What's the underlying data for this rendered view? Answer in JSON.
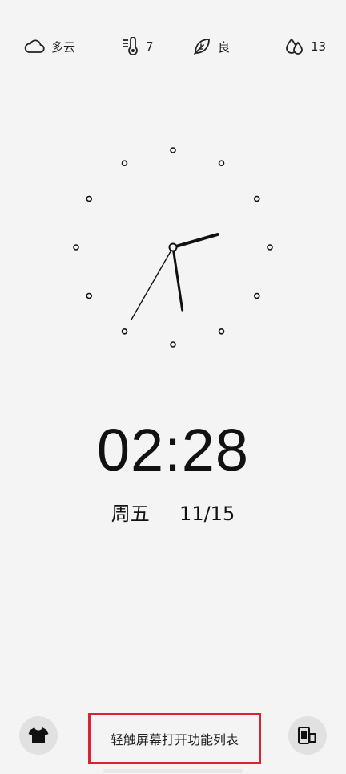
{
  "status": {
    "weather": {
      "icon": "cloud-icon",
      "label": "多云"
    },
    "temperature": {
      "icon": "thermometer-icon",
      "value": "7"
    },
    "air_quality": {
      "icon": "leaf-icon",
      "label": "良"
    },
    "humidity": {
      "icon": "water-drops-icon",
      "value": "13"
    }
  },
  "clock": {
    "hour": 2,
    "minute": 28,
    "second": 35
  },
  "time_text": "02:28",
  "date": {
    "weekday": "周五",
    "day": "11/15"
  },
  "bottom": {
    "hint": "轻触屏幕打开功能列表",
    "left_icon": "tshirt-icon",
    "right_icon": "devices-icon"
  },
  "colors": {
    "background": "#f4f4f4",
    "highlight_border": "#d62432"
  }
}
